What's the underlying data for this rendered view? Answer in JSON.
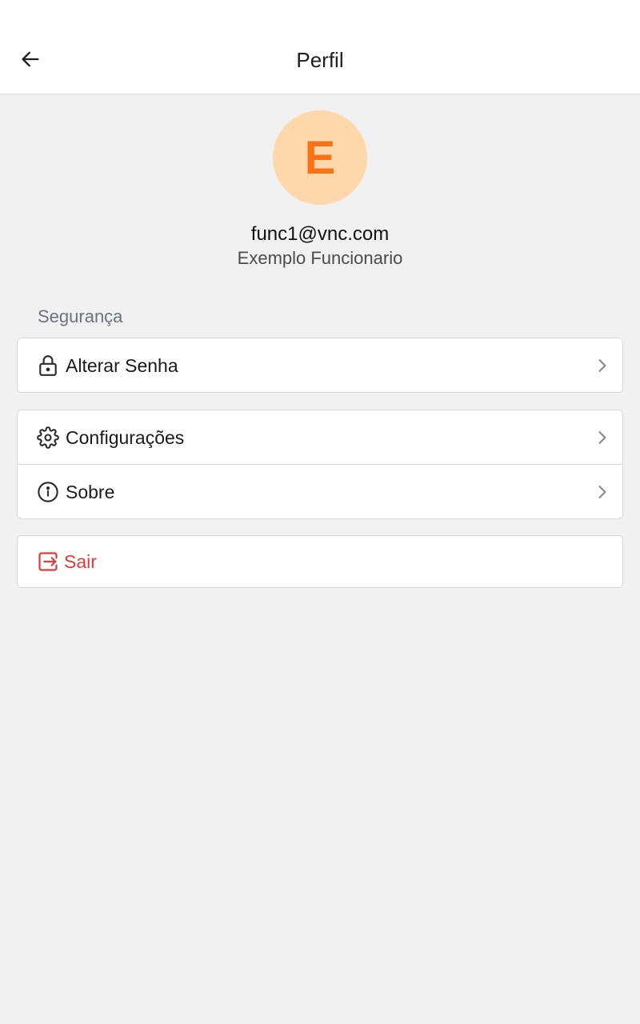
{
  "header": {
    "title": "Perfil",
    "back_icon": "arrow-left-icon"
  },
  "profile": {
    "avatar_letter": "E",
    "avatar_bg": "#fed7aa",
    "avatar_fg": "#f97316",
    "email": "func1@vnc.com",
    "name": "Exemplo Funcionario"
  },
  "security": {
    "section_label": "Segurança",
    "items": [
      {
        "label": "Alterar Senha",
        "icon": "lock-icon"
      }
    ]
  },
  "general": {
    "items": [
      {
        "label": "Configurações",
        "icon": "gear-icon"
      },
      {
        "label": "Sobre",
        "icon": "info-icon"
      }
    ]
  },
  "logout": {
    "label": "Sair",
    "icon": "logout-icon",
    "color": "#dc3c3c"
  }
}
